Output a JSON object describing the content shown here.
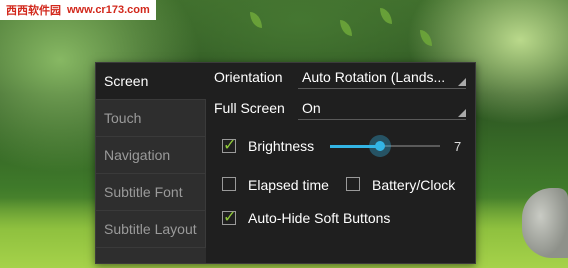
{
  "watermark": {
    "site_name": "西西软件园",
    "url": "www.cr173.com"
  },
  "sidebar": {
    "tabs": [
      {
        "label": "Screen"
      },
      {
        "label": "Touch"
      },
      {
        "label": "Navigation"
      },
      {
        "label": "Subtitle Font"
      },
      {
        "label": "Subtitle Layout"
      }
    ],
    "active_tab": "Screen"
  },
  "screen": {
    "orientation": {
      "label": "Orientation",
      "value": "Auto Rotation (Lands..."
    },
    "full_screen": {
      "label": "Full Screen",
      "value": "On"
    },
    "brightness": {
      "label": "Brightness",
      "checked": true,
      "value": "7",
      "level_fraction": 0.45
    },
    "elapsed_time": {
      "label": "Elapsed time",
      "checked": false
    },
    "battery_clock": {
      "label": "Battery/Clock",
      "checked": false
    },
    "auto_hide": {
      "label": "Auto-Hide Soft Buttons",
      "checked": true
    }
  },
  "colors": {
    "accent": "#33b5e5",
    "check": "#8fc83a",
    "dialog_bg": "#1f1f1f"
  }
}
